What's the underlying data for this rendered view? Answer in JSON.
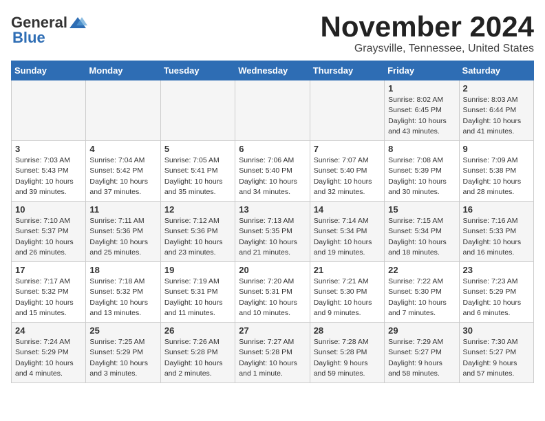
{
  "header": {
    "logo_general": "General",
    "logo_blue": "Blue",
    "month_title": "November 2024",
    "location": "Graysville, Tennessee, United States"
  },
  "weekdays": [
    "Sunday",
    "Monday",
    "Tuesday",
    "Wednesday",
    "Thursday",
    "Friday",
    "Saturday"
  ],
  "weeks": [
    [
      {
        "day": "",
        "info": ""
      },
      {
        "day": "",
        "info": ""
      },
      {
        "day": "",
        "info": ""
      },
      {
        "day": "",
        "info": ""
      },
      {
        "day": "",
        "info": ""
      },
      {
        "day": "1",
        "info": "Sunrise: 8:02 AM\nSunset: 6:45 PM\nDaylight: 10 hours and 43 minutes."
      },
      {
        "day": "2",
        "info": "Sunrise: 8:03 AM\nSunset: 6:44 PM\nDaylight: 10 hours and 41 minutes."
      }
    ],
    [
      {
        "day": "3",
        "info": "Sunrise: 7:03 AM\nSunset: 5:43 PM\nDaylight: 10 hours and 39 minutes."
      },
      {
        "day": "4",
        "info": "Sunrise: 7:04 AM\nSunset: 5:42 PM\nDaylight: 10 hours and 37 minutes."
      },
      {
        "day": "5",
        "info": "Sunrise: 7:05 AM\nSunset: 5:41 PM\nDaylight: 10 hours and 35 minutes."
      },
      {
        "day": "6",
        "info": "Sunrise: 7:06 AM\nSunset: 5:40 PM\nDaylight: 10 hours and 34 minutes."
      },
      {
        "day": "7",
        "info": "Sunrise: 7:07 AM\nSunset: 5:40 PM\nDaylight: 10 hours and 32 minutes."
      },
      {
        "day": "8",
        "info": "Sunrise: 7:08 AM\nSunset: 5:39 PM\nDaylight: 10 hours and 30 minutes."
      },
      {
        "day": "9",
        "info": "Sunrise: 7:09 AM\nSunset: 5:38 PM\nDaylight: 10 hours and 28 minutes."
      }
    ],
    [
      {
        "day": "10",
        "info": "Sunrise: 7:10 AM\nSunset: 5:37 PM\nDaylight: 10 hours and 26 minutes."
      },
      {
        "day": "11",
        "info": "Sunrise: 7:11 AM\nSunset: 5:36 PM\nDaylight: 10 hours and 25 minutes."
      },
      {
        "day": "12",
        "info": "Sunrise: 7:12 AM\nSunset: 5:36 PM\nDaylight: 10 hours and 23 minutes."
      },
      {
        "day": "13",
        "info": "Sunrise: 7:13 AM\nSunset: 5:35 PM\nDaylight: 10 hours and 21 minutes."
      },
      {
        "day": "14",
        "info": "Sunrise: 7:14 AM\nSunset: 5:34 PM\nDaylight: 10 hours and 19 minutes."
      },
      {
        "day": "15",
        "info": "Sunrise: 7:15 AM\nSunset: 5:34 PM\nDaylight: 10 hours and 18 minutes."
      },
      {
        "day": "16",
        "info": "Sunrise: 7:16 AM\nSunset: 5:33 PM\nDaylight: 10 hours and 16 minutes."
      }
    ],
    [
      {
        "day": "17",
        "info": "Sunrise: 7:17 AM\nSunset: 5:32 PM\nDaylight: 10 hours and 15 minutes."
      },
      {
        "day": "18",
        "info": "Sunrise: 7:18 AM\nSunset: 5:32 PM\nDaylight: 10 hours and 13 minutes."
      },
      {
        "day": "19",
        "info": "Sunrise: 7:19 AM\nSunset: 5:31 PM\nDaylight: 10 hours and 11 minutes."
      },
      {
        "day": "20",
        "info": "Sunrise: 7:20 AM\nSunset: 5:31 PM\nDaylight: 10 hours and 10 minutes."
      },
      {
        "day": "21",
        "info": "Sunrise: 7:21 AM\nSunset: 5:30 PM\nDaylight: 10 hours and 9 minutes."
      },
      {
        "day": "22",
        "info": "Sunrise: 7:22 AM\nSunset: 5:30 PM\nDaylight: 10 hours and 7 minutes."
      },
      {
        "day": "23",
        "info": "Sunrise: 7:23 AM\nSunset: 5:29 PM\nDaylight: 10 hours and 6 minutes."
      }
    ],
    [
      {
        "day": "24",
        "info": "Sunrise: 7:24 AM\nSunset: 5:29 PM\nDaylight: 10 hours and 4 minutes."
      },
      {
        "day": "25",
        "info": "Sunrise: 7:25 AM\nSunset: 5:29 PM\nDaylight: 10 hours and 3 minutes."
      },
      {
        "day": "26",
        "info": "Sunrise: 7:26 AM\nSunset: 5:28 PM\nDaylight: 10 hours and 2 minutes."
      },
      {
        "day": "27",
        "info": "Sunrise: 7:27 AM\nSunset: 5:28 PM\nDaylight: 10 hours and 1 minute."
      },
      {
        "day": "28",
        "info": "Sunrise: 7:28 AM\nSunset: 5:28 PM\nDaylight: 9 hours and 59 minutes."
      },
      {
        "day": "29",
        "info": "Sunrise: 7:29 AM\nSunset: 5:27 PM\nDaylight: 9 hours and 58 minutes."
      },
      {
        "day": "30",
        "info": "Sunrise: 7:30 AM\nSunset: 5:27 PM\nDaylight: 9 hours and 57 minutes."
      }
    ]
  ]
}
